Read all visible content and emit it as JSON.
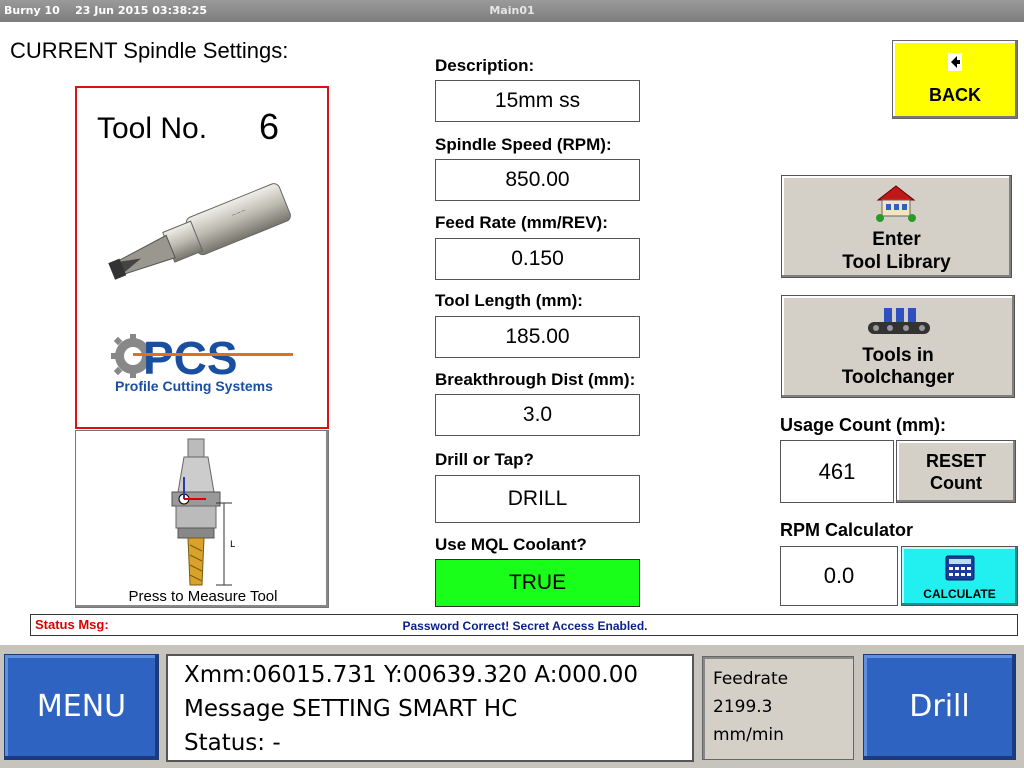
{
  "window": {
    "app": "Burny 10",
    "datetime": "23 Jun 2015  03:38:25",
    "screen": "Main01"
  },
  "page_title": "CURRENT Spindle Settings:",
  "tool": {
    "label": "Tool No.",
    "number": "6"
  },
  "logo": {
    "brand": "PCS",
    "tagline": "Profile Cutting Systems"
  },
  "measure": {
    "label": "Press to Measure Tool"
  },
  "fields": {
    "description": {
      "label": "Description:",
      "value": "15mm ss"
    },
    "spindle_speed": {
      "label": "Spindle Speed (RPM):",
      "value": "850.00"
    },
    "feed_rate": {
      "label": "Feed Rate (mm/REV):",
      "value": "0.150"
    },
    "tool_length": {
      "label": "Tool Length (mm):",
      "value": "185.00"
    },
    "breakthrough": {
      "label": "Breakthrough Dist (mm):",
      "value": "3.0"
    },
    "drill_or_tap": {
      "label": "Drill or Tap?",
      "value": "DRILL"
    },
    "mql_coolant": {
      "label": "Use MQL Coolant?",
      "value": "TRUE"
    }
  },
  "buttons": {
    "back": "BACK",
    "tool_library_line1": "Enter",
    "tool_library_line2": "Tool Library",
    "toolchanger_line1": "Tools in",
    "toolchanger_line2": "Toolchanger",
    "reset_line1": "RESET",
    "reset_line2": "Count",
    "calculate": "CALCULATE"
  },
  "usage": {
    "label": "Usage Count (mm):",
    "value": "461"
  },
  "rpm_calc": {
    "label": "RPM Calculator",
    "value": "0.0"
  },
  "status": {
    "label": "Status Msg:",
    "message": "Password Correct! Secret Access Enabled."
  },
  "bottom": {
    "menu": "MENU",
    "position": "Xmm:06015.731 Y:00639.320 A:000.00",
    "message": "Message SETTING SMART HC",
    "status": "Status:  -",
    "feed_label": "Feedrate",
    "feed_value": "2199.3",
    "feed_unit": "mm/min",
    "drill": "Drill"
  },
  "colors": {
    "back": "#ffff00",
    "coolant_true": "#1aff1a",
    "calculate": "#22f0f0",
    "bottom_buttons": "#2e63c2",
    "tool_card_border": "#dd1111"
  }
}
